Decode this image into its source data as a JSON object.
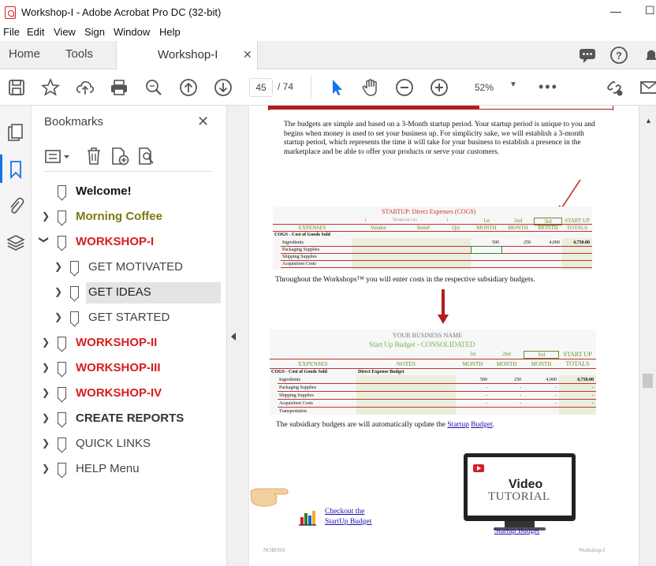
{
  "window": {
    "title": "Workshop-I - Adobe Acrobat Pro DC (32-bit)"
  },
  "menu": [
    "File",
    "Edit",
    "View",
    "Sign",
    "Window",
    "Help"
  ],
  "tabs": {
    "home": "Home",
    "tools": "Tools",
    "document": "Workshop-I"
  },
  "toolbar": {
    "current_page": "45",
    "total_pages": "/ 74",
    "zoom": "52%"
  },
  "bookmarks": {
    "title": "Bookmarks",
    "items": [
      {
        "label": "Welcome!",
        "color": "#111111",
        "bold": true
      },
      {
        "label": "Morning Coffee",
        "color": "#7a7a10",
        "bold": true
      },
      {
        "label": "WORKSHOP-I",
        "color": "#d71e1e",
        "bold": true
      },
      {
        "label": "GET MOTIVATED",
        "color": "#444444",
        "bold": false
      },
      {
        "label": "GET IDEAS",
        "color": "#222222",
        "bold": false
      },
      {
        "label": "GET STARTED",
        "color": "#444444",
        "bold": false
      },
      {
        "label": "WORKSHOP-II",
        "color": "#d71e1e",
        "bold": true
      },
      {
        "label": "WORKSHOP-III",
        "color": "#d71e1e",
        "bold": true
      },
      {
        "label": "WORKSHOP-IV",
        "color": "#d71e1e",
        "bold": true
      },
      {
        "label": "CREATE REPORTS",
        "color": "#333333",
        "bold": true
      },
      {
        "label": "QUICK LINKS",
        "color": "#444444",
        "bold": false
      },
      {
        "label": "HELP Menu",
        "color": "#444444",
        "bold": false
      }
    ]
  },
  "document": {
    "intro": "The budgets are simple and based on a 3-Month startup period.  Your startup period is unique to you and begins when money is used to set your business up. For simplicity sake, we will establish a 3-month startup period, which represents the time it will take for your business to establish a presence in the marketplace and be able to offer your products or serve your customers.",
    "sheet1": {
      "title": "STARTUP: Direct Expenses (COGS)",
      "shopping_list": "Shopping List",
      "headers": [
        "EXPENSES",
        "Vendor",
        "Item#",
        "Qty",
        "MONTH",
        "MONTH",
        "MONTH",
        "TOTALS"
      ],
      "month_tags": [
        "1st",
        "2nd",
        "3rd",
        "START UP"
      ],
      "section": "COGS - Cost of Goods Sold",
      "rows": [
        "Ingredients",
        "Packaging Supplies",
        "Shipping Supplies",
        "Acquisition Costs"
      ],
      "ingredients_values": [
        "500",
        "250",
        "4,000",
        "4,750.00"
      ]
    },
    "between_text": "Throughout the Workshops™ you will enter costs in the respective subsidiary budgets.",
    "sheet2": {
      "business": "YOUR BUSINESS NAME",
      "title": "Start Up Budget - CONSOLIDATED",
      "headers": [
        "EXPENSES",
        "NOTES",
        "MONTH",
        "MONTH",
        "MONTH",
        "TOTALS"
      ],
      "month_tags": [
        "1st",
        "2nd",
        "3rd",
        "START UP"
      ],
      "section": "COGS - Cost of Goods Sold",
      "note": "Direct Expense Budget",
      "rows": [
        "Ingredients",
        "Packaging Supplies",
        "Shipping Supplies",
        "Acquisition Costs",
        "Transportation"
      ],
      "ingredients_values": [
        "500",
        "250",
        "4,000",
        "4,750.00"
      ],
      "dash": "-"
    },
    "update_text_prefix": "The subsidiary budgets are will automatically update the ",
    "update_link_1": "Startup",
    "update_link_2": "Budget",
    "update_text_suffix": ".",
    "checkout_1": "Checkout the",
    "checkout_2": "StartUp Budget",
    "video_big": "Video",
    "video_small": "TUTORIAL",
    "video_link": "Startup Budget",
    "footer_left": "NOBOSS",
    "footer_right": "Workshop-I"
  }
}
